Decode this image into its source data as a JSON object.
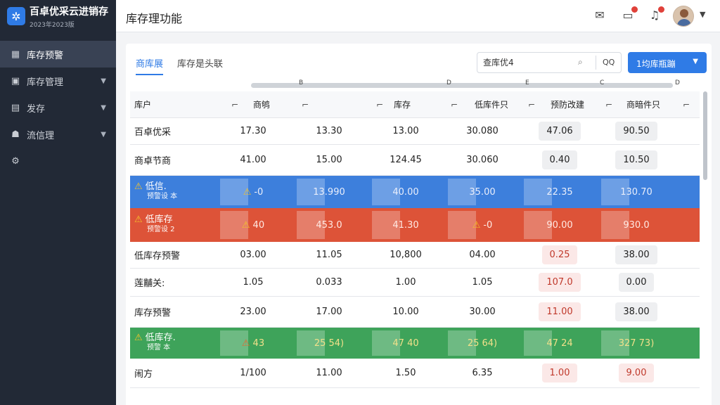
{
  "brand": {
    "name": "百卓优采云进销存",
    "subtitle": "2023年2023版"
  },
  "header": {
    "title": "库存理功能"
  },
  "sidebar": {
    "items": [
      {
        "label": "库存预警",
        "icon": "chart-icon",
        "active": true,
        "expand": false
      },
      {
        "label": "库存管理",
        "icon": "box-icon",
        "active": false,
        "expand": true
      },
      {
        "label": "发存",
        "icon": "stack-icon",
        "active": false,
        "expand": true
      },
      {
        "label": "流信理",
        "icon": "user-icon",
        "active": false,
        "expand": true
      },
      {
        "label": "",
        "icon": "settings-icon",
        "active": false,
        "expand": false
      }
    ]
  },
  "tabs": [
    {
      "label": "商库展"
    },
    {
      "label": "库存是头联"
    }
  ],
  "search": {
    "value": "查库优4",
    "qq": "QQ"
  },
  "action_button": {
    "label": "1均库瓶蹦"
  },
  "ruler": [
    "B",
    "D",
    "E",
    "C",
    "D"
  ],
  "table": {
    "headers": [
      "库户",
      "商鸲",
      "",
      "库存",
      "",
      "低库件只",
      "预防改建",
      "商暗件只"
    ],
    "rows": [
      {
        "type": "normal",
        "name": "百卓优采",
        "sub": "",
        "v": [
          "17.30",
          "13.30",
          "13.00",
          "30.080",
          "47.06",
          "90.50"
        ],
        "pill4": "gray",
        "pill5": "gray"
      },
      {
        "type": "normal",
        "name": "商卓节商",
        "sub": "",
        "v": [
          "41.00",
          "15.00",
          "124.45",
          "30.060",
          "0.40",
          "10.50"
        ],
        "pill4": "gray",
        "pill5": "gray"
      },
      {
        "type": "blue",
        "name": "低信.",
        "sub": "预警设 本",
        "v": [
          "-0",
          "13.990",
          "40.00",
          "35.00",
          "22.35",
          "130.70"
        ]
      },
      {
        "type": "orange",
        "name": "低库存",
        "sub": "预警设 2",
        "v": [
          "40",
          "453.0",
          "41.30",
          "-0",
          "90.00",
          "930.0"
        ]
      },
      {
        "type": "normal",
        "name": "低库存预警",
        "sub": "",
        "v": [
          "03.00",
          "11.05",
          "10,800",
          "04.00",
          "0.25",
          "38.00"
        ],
        "pill4": "red",
        "pill5": "gray"
      },
      {
        "type": "normal",
        "name": "莲黼关:",
        "sub": "",
        "v": [
          "1.05",
          "0.033",
          "1.00",
          "1.05",
          "107.0",
          "0.00"
        ],
        "pill4": "red",
        "pill5": "gray"
      },
      {
        "type": "normal",
        "name": "库存预警",
        "sub": "",
        "v": [
          "23.00",
          "17.00",
          "10.00",
          "30.00",
          "11.00",
          "38.00"
        ],
        "pill4": "red",
        "pill5": "gray"
      },
      {
        "type": "green",
        "name": "低库存.",
        "sub": "预警 本",
        "v": [
          "43",
          "25 54)",
          "47 40",
          "25 64)",
          "47 24",
          "327 73)"
        ]
      },
      {
        "type": "normal",
        "name": "闹方",
        "sub": "",
        "v": [
          "1/100",
          "11.00",
          "1.50",
          "6.35",
          "1.00",
          "9.00"
        ],
        "pill4": "red",
        "pill5": "red"
      }
    ]
  },
  "colors": {
    "accent": "#2f7be6",
    "sidebar": "#222936",
    "row_blue": "#3d7fdc",
    "row_orange": "#dd5338",
    "row_green": "#3ea35a"
  }
}
